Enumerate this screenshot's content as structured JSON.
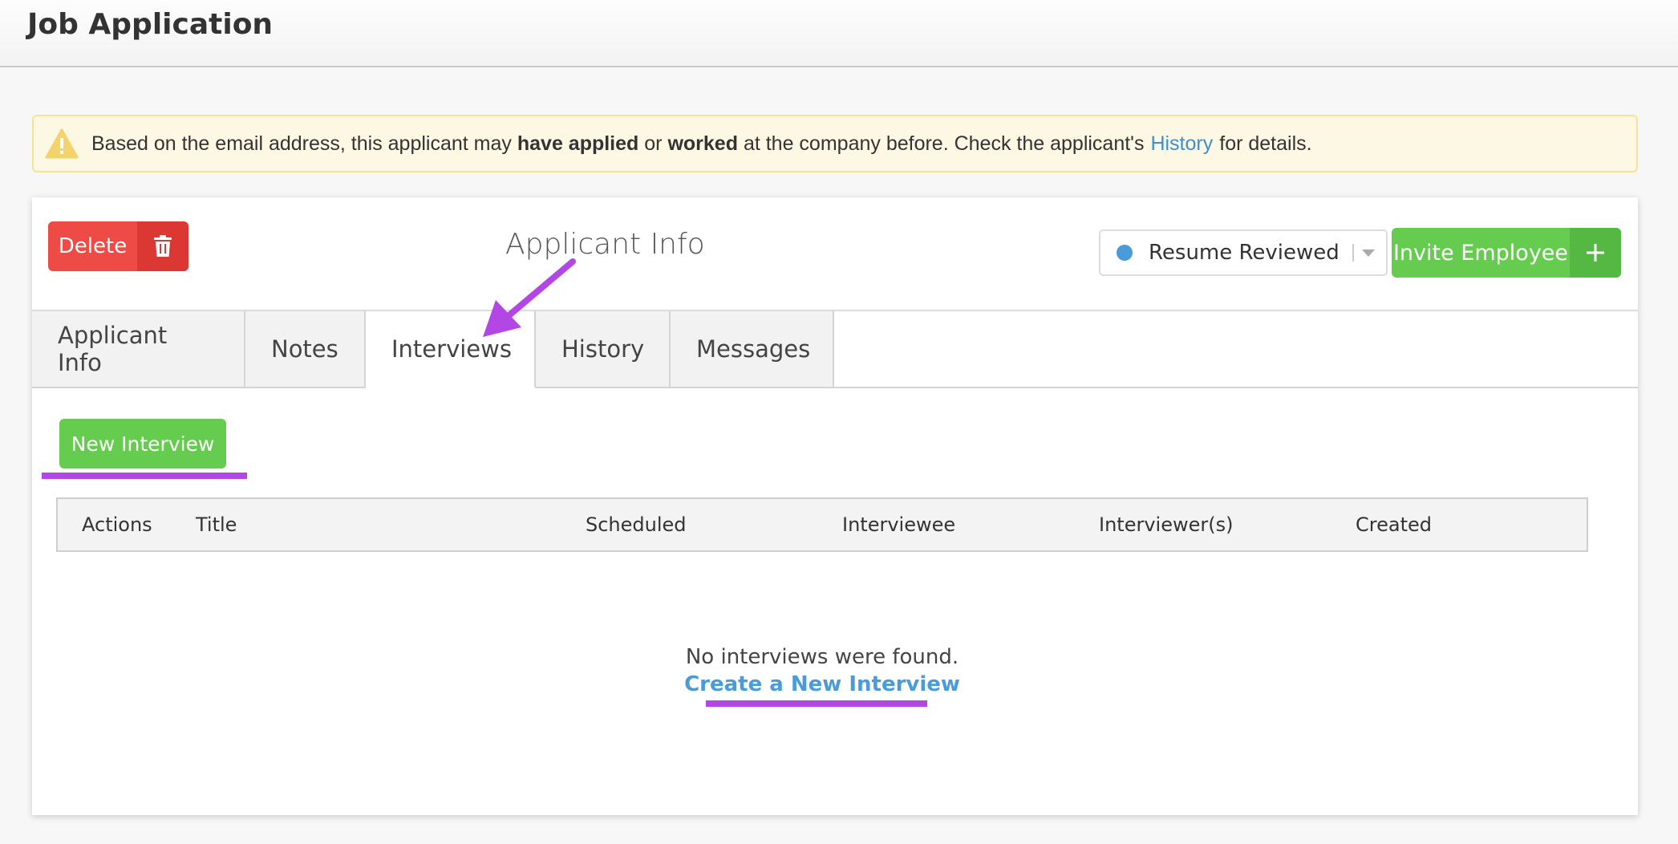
{
  "header": {
    "title": "Job Application"
  },
  "alert": {
    "text_before": "Based on the email address, this applicant may",
    "bold_1": "have applied",
    "text_or": "or",
    "bold_2": "worked",
    "text_middle": "at the company before. Check the applicant's",
    "link": "History",
    "text_after": "for details.",
    "icon": "warning-icon"
  },
  "panel": {
    "delete_label": "Delete",
    "delete_icon": "trash-icon",
    "heading": "Applicant Info",
    "status": {
      "value": "Resume Reviewed",
      "dot_color": "#4a9bd9"
    },
    "invite_label": "Invite Employee",
    "invite_icon": "plus-icon"
  },
  "tabs": [
    {
      "label": "Applicant Info",
      "active": false
    },
    {
      "label": "Notes",
      "active": false
    },
    {
      "label": "Interviews",
      "active": true
    },
    {
      "label": "History",
      "active": false
    },
    {
      "label": "Messages",
      "active": false
    }
  ],
  "interviews": {
    "new_button": "New Interview",
    "columns": [
      "Actions",
      "Title",
      "Scheduled",
      "Interviewee",
      "Interviewer(s)",
      "Created"
    ],
    "empty_message": "No interviews were found.",
    "create_link": "Create a New Interview"
  },
  "colors": {
    "danger": "#ee4b47",
    "success": "#66cc4f",
    "link": "#3d8fd1",
    "annotation": "#b247e6"
  }
}
